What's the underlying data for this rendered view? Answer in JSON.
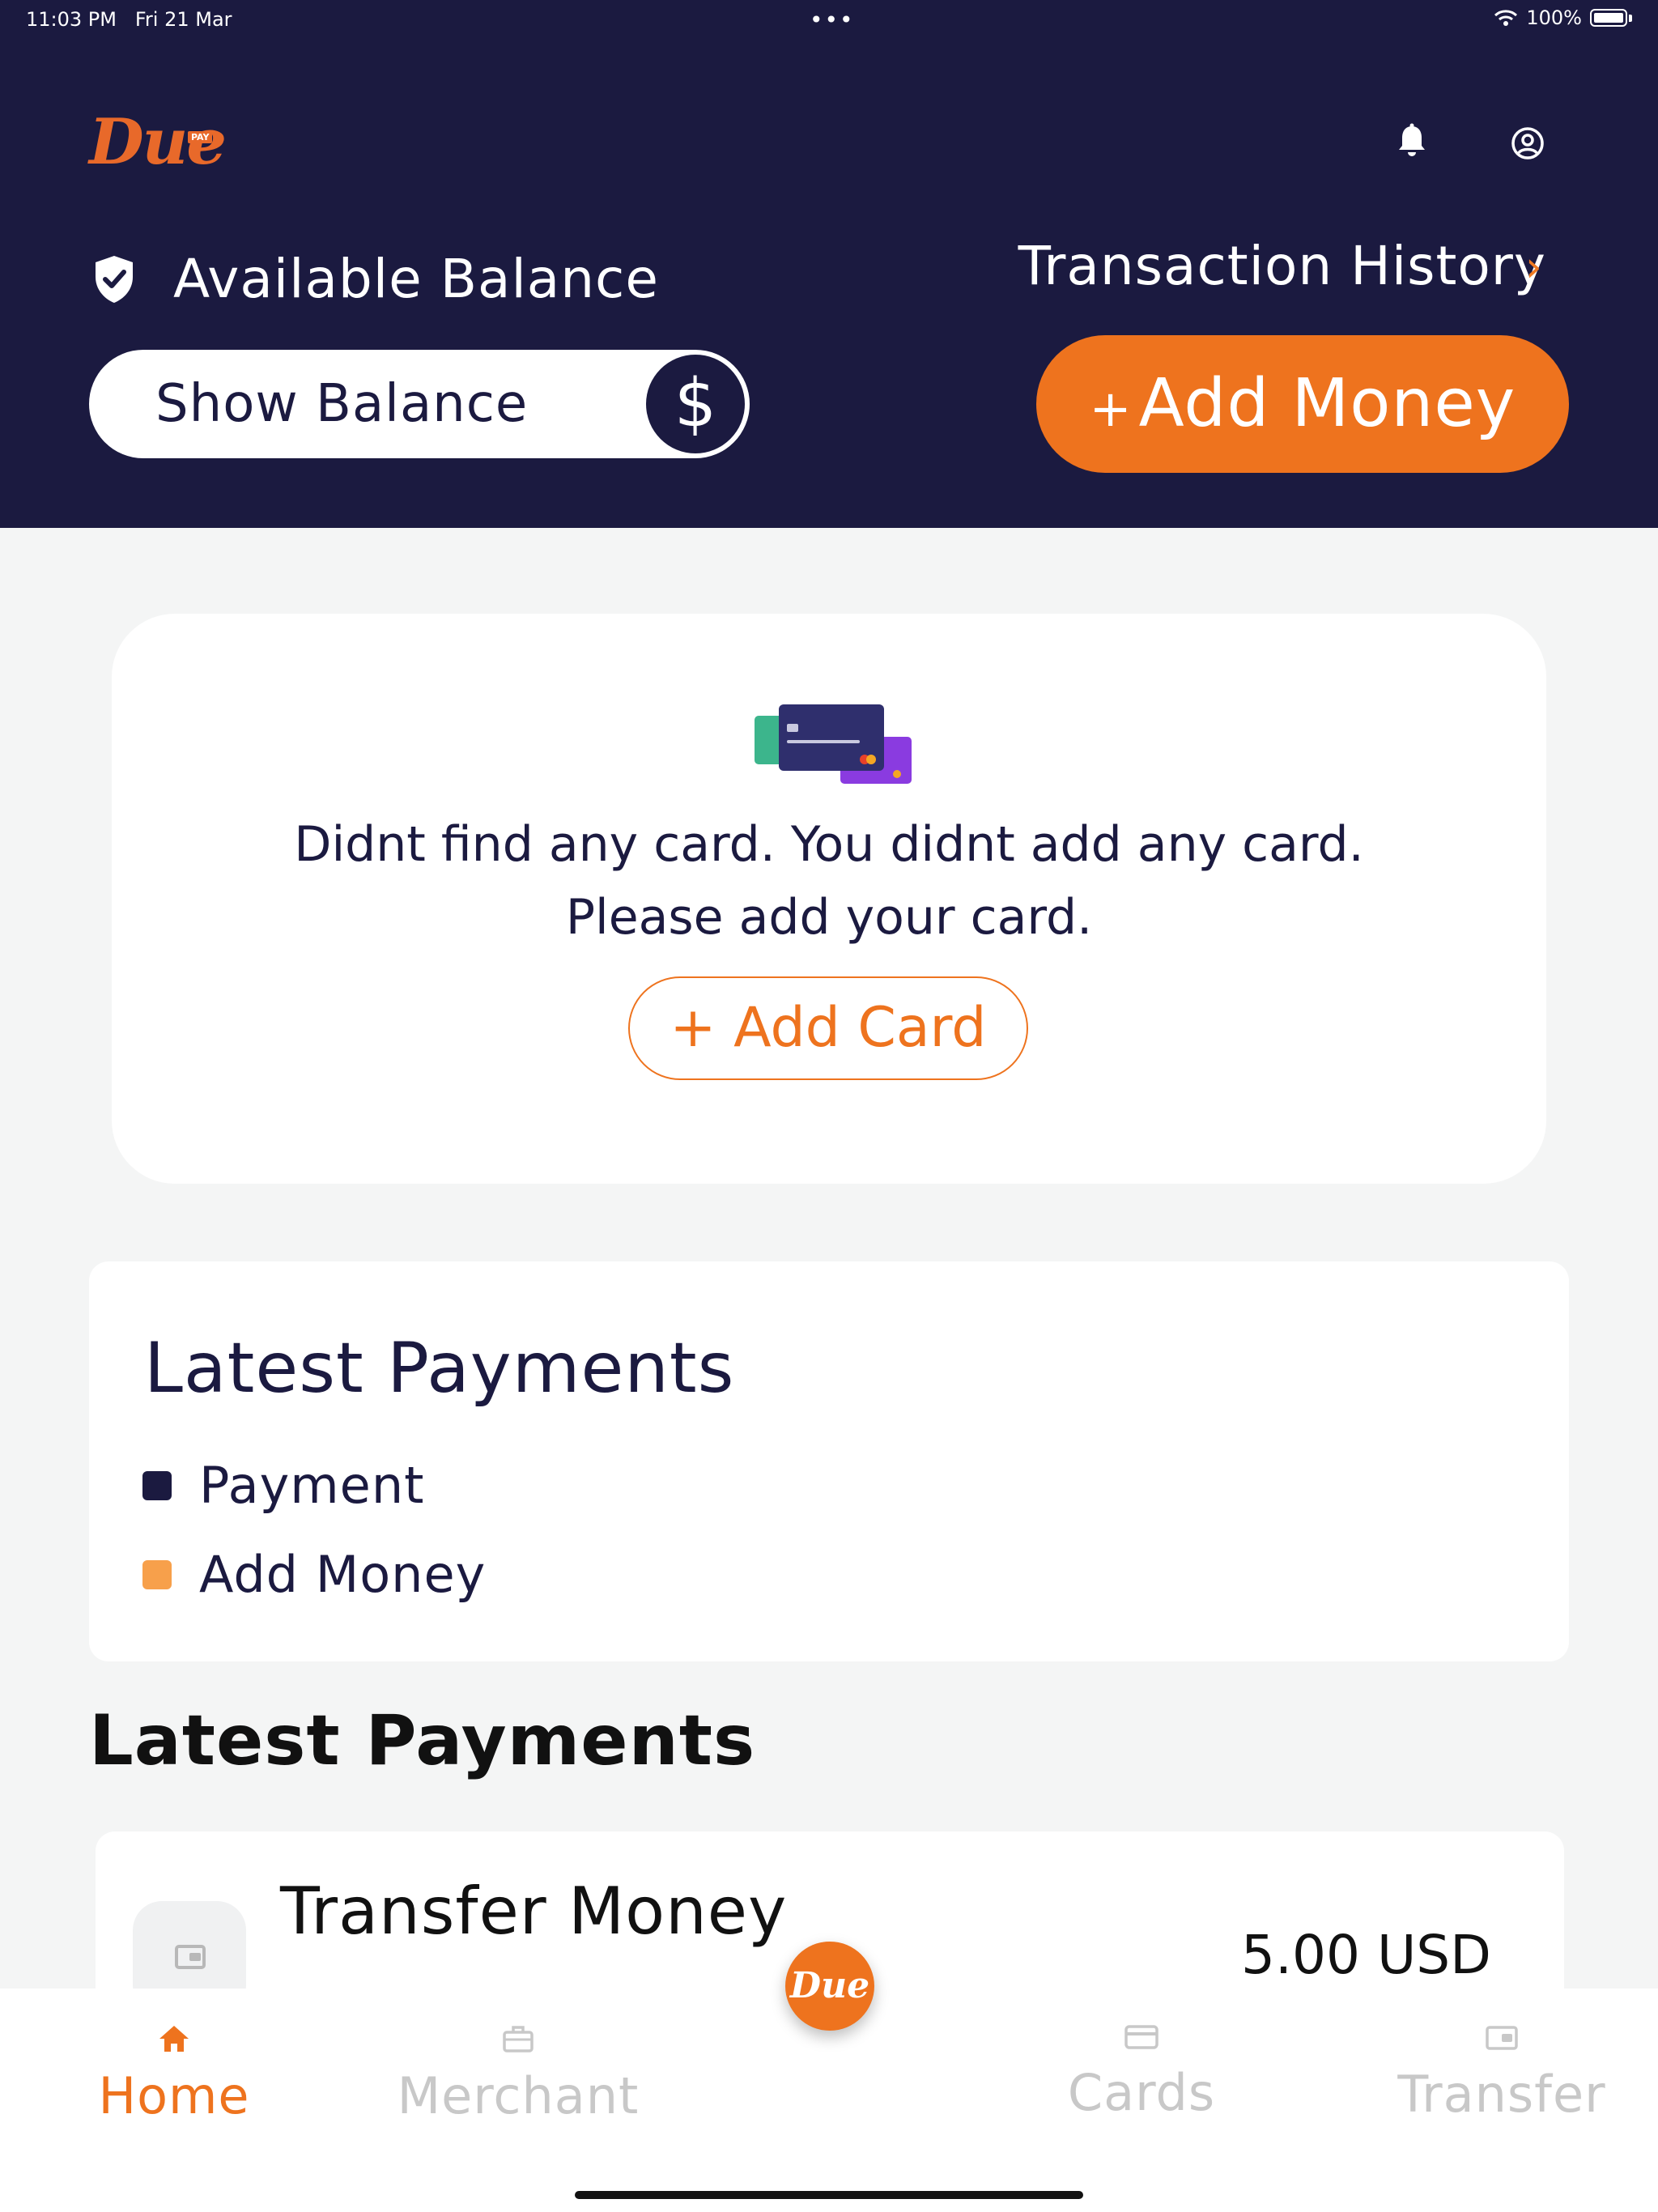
{
  "status_bar": {
    "time": "11:03 PM",
    "date": "Fri 21 Mar",
    "dots": "•••",
    "battery": "100%"
  },
  "header": {
    "logo": "Due",
    "logo_tag": "PAY",
    "available_balance_label": "Available Balance",
    "transaction_history_label": "Transaction History",
    "show_balance_label": "Show Balance",
    "currency_symbol": "$",
    "add_money_plus": "+",
    "add_money_label": "Add Money"
  },
  "card_panel": {
    "empty_line1": "Didnt find any card. You didnt add any card.",
    "empty_line2": "Please add your card.",
    "add_card_label": "+ Add Card"
  },
  "chart": {
    "title": "Latest Payments",
    "legend": [
      {
        "label": "Payment",
        "color": "#1b1a40"
      },
      {
        "label": "Add Money",
        "color": "#f7a04b"
      }
    ]
  },
  "latest_payments": {
    "title": "Latest Payments",
    "items": [
      {
        "title": "Transfer Money",
        "amount": "5.00 USD",
        "icon": "wallet-icon"
      }
    ]
  },
  "bottom_nav": {
    "items": [
      {
        "label": "Home",
        "icon": "home-icon",
        "active": true
      },
      {
        "label": "Merchant",
        "icon": "briefcase-icon",
        "active": false
      },
      {
        "label": "Cards",
        "icon": "card-icon",
        "active": false
      },
      {
        "label": "Transfer",
        "icon": "wallet-icon",
        "active": false
      }
    ],
    "center_logo": "Due"
  },
  "colors": {
    "navy": "#1b1a40",
    "orange": "#ee731e",
    "legend_orange": "#f7a04b"
  }
}
